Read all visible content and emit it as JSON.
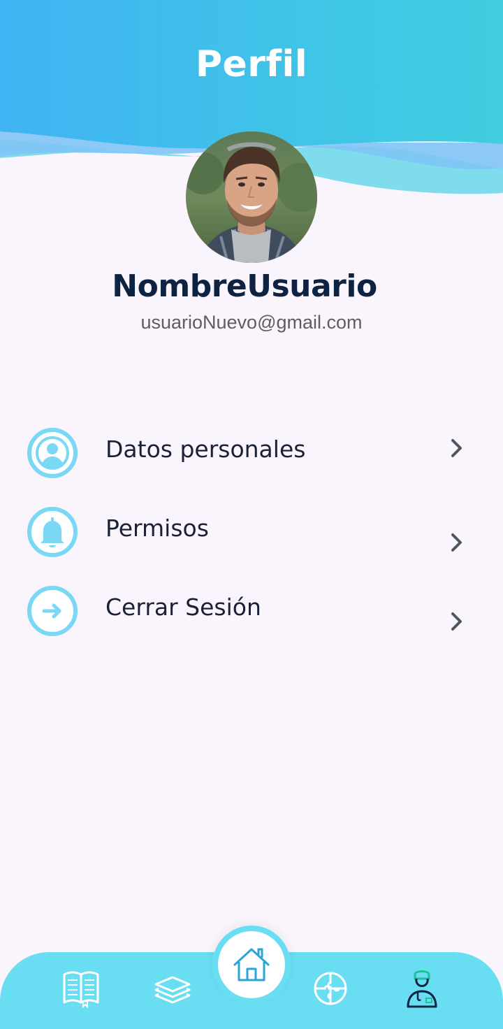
{
  "header": {
    "title": "Perfil"
  },
  "profile": {
    "name": "NombreUsuario",
    "email": "usuarioNuevo@gmail.com"
  },
  "menu": {
    "items": [
      {
        "label": "Datos personales",
        "icon": "user-icon"
      },
      {
        "label": "Permisos",
        "icon": "bell-icon"
      },
      {
        "label": "Cerrar Sesión",
        "icon": "arrow-right-icon"
      }
    ]
  },
  "nav": {
    "items": [
      "book-icon",
      "layers-icon",
      "home-icon",
      "puzzle-icon",
      "doctor-icon"
    ]
  },
  "colors": {
    "header_gradient_start": "#40B4F2",
    "header_gradient_end": "#40CEE0",
    "accent": "#7BD8F4",
    "nav_bar": "#69DDF2",
    "background": "#FAF5FC",
    "title_text": "#0E2341"
  }
}
